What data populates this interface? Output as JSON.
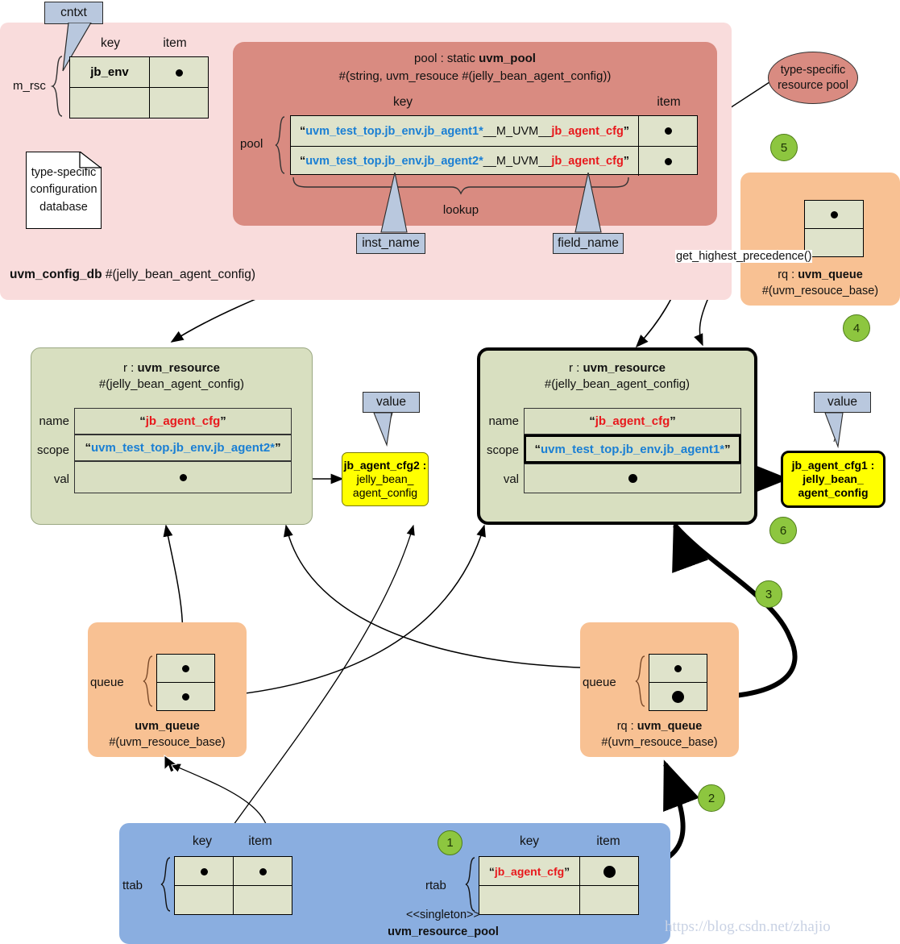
{
  "diagram": {
    "title": "uvm_config_db / uvm_resource_pool lookup flow",
    "watermark": "https://blog.csdn.net/zhajio"
  },
  "config_db": {
    "caption_bold": "uvm_config_db",
    "caption_rest": " #(jelly_bean_agent_config)",
    "m_rsc_label": "m_rsc",
    "col_key": "key",
    "col_item": "item",
    "cell_key": "jb_env",
    "cntxt_callout": "cntxt",
    "note_line1": "type-specific",
    "note_line2": "configuration",
    "note_line3": "database"
  },
  "pool": {
    "title_prefix": "pool : static ",
    "title_bold": "uvm_pool",
    "title_sub": "#(string, uvm_resouce #(jelly_bean_agent_config))",
    "col_key": "key",
    "col_item": "item",
    "pool_label": "pool",
    "lookup_label": "lookup",
    "rows": [
      {
        "inst": "uvm_test_top.jb_env.jb_agent1*",
        "mid": "__M_UVM__",
        "field": "jb_agent_cfg"
      },
      {
        "inst": "uvm_test_top.jb_env.jb_agent2*",
        "mid": "__M_UVM__",
        "field": "jb_agent_cfg"
      }
    ],
    "inst_callout": "inst_name",
    "field_callout": "field_name"
  },
  "type_specific_pool": {
    "line1": "type-specific",
    "line2": "resource pool"
  },
  "rq_top": {
    "title_prefix": "rq : ",
    "title_bold": "uvm_queue",
    "title_sub": "#(uvm_resouce_base)",
    "method_label": "get_highest_precedence()"
  },
  "resource_left": {
    "title_prefix": "r : ",
    "title_bold": "uvm_resource",
    "title_sub": "#(jelly_bean_agent_config)",
    "label_name": "name",
    "label_scope": "scope",
    "label_val": "val",
    "name_value": "jb_agent_cfg",
    "scope_value": "uvm_test_top.jb_env.jb_agent2*",
    "value_callout": "value",
    "note_head": "jb_agent_cfg2 :",
    "note_line2": "jelly_bean_",
    "note_line3": "agent_config"
  },
  "resource_right": {
    "title_prefix": "r : ",
    "title_bold": "uvm_resource",
    "title_sub": "#(jelly_bean_agent_config)",
    "label_name": "name",
    "label_scope": "scope",
    "label_val": "val",
    "name_value": "jb_agent_cfg",
    "scope_value": "uvm_test_top.jb_env.jb_agent1*",
    "value_callout": "value",
    "note_head": "jb_agent_cfg1 :",
    "note_line2": "jelly_bean_",
    "note_line3": "agent_config"
  },
  "queue_left": {
    "queue_label": "queue",
    "title_bold": "uvm_queue",
    "title_sub": "#(uvm_resouce_base)"
  },
  "queue_right": {
    "queue_label": "queue",
    "title_prefix": "rq : ",
    "title_bold": "uvm_queue",
    "title_sub": "#(uvm_resouce_base)"
  },
  "resource_pool": {
    "stereotype": "<<singleton>>",
    "name": "uvm_resource_pool",
    "ttab_label": "ttab",
    "rtab_label": "rtab",
    "ttab_col_key": "key",
    "ttab_col_item": "item",
    "rtab_col_key": "key",
    "rtab_col_item": "item",
    "rtab_key_value": "jb_agent_cfg"
  },
  "steps": {
    "s1": "1",
    "s2": "2",
    "s3": "3",
    "s4": "4",
    "s5": "5",
    "s6": "6"
  },
  "colors": {
    "config_db_panel": "#f9dcdc",
    "pool_panel": "#d98b81",
    "queue_panel": "#f8c193",
    "resource_pool_panel": "#8aaee0",
    "resource_box": "#d8dfc0",
    "table_cell": "#dfe3cb",
    "callout": "#b9c8de",
    "value_note": "#ffff00",
    "step_circle": "#8dc63f",
    "key_blue": "#1a7fd4",
    "key_red": "#e8181c"
  }
}
